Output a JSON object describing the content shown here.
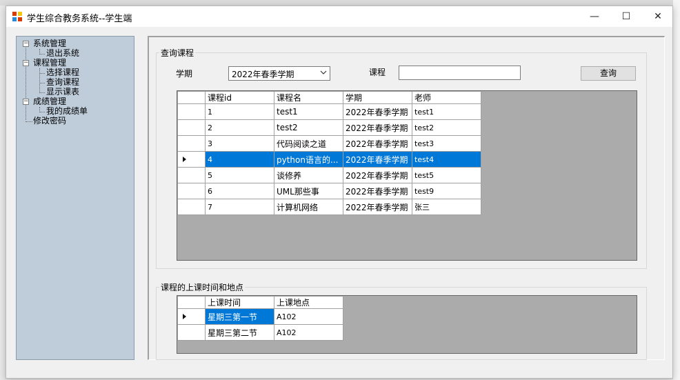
{
  "window": {
    "title": "学生综合教务系统--学生端"
  },
  "title_controls": {
    "minimize": "—",
    "maximize": "☐",
    "close": "✕"
  },
  "tree": {
    "nodes": [
      {
        "label": "系统管理",
        "children": [
          {
            "label": "退出系统"
          }
        ]
      },
      {
        "label": "课程管理",
        "children": [
          {
            "label": "选择课程"
          },
          {
            "label": "查询课程"
          },
          {
            "label": "显示课表"
          }
        ]
      },
      {
        "label": "成绩管理",
        "children": [
          {
            "label": "我的成绩单"
          }
        ]
      },
      {
        "label": "修改密码"
      }
    ],
    "expander": "−"
  },
  "query_group": {
    "title": "查询课程",
    "term_label": "学期",
    "term_value": "2022年春季学期",
    "course_label": "课程",
    "course_value": "",
    "search_button": "查询"
  },
  "course_table": {
    "columns": [
      "课程id",
      "课程名",
      "学期",
      "老师"
    ],
    "selected_row": 3,
    "rows": [
      [
        "1",
        "test1",
        "2022年春季学期",
        "test1"
      ],
      [
        "2",
        "test2",
        "2022年春季学期",
        "test2"
      ],
      [
        "3",
        "代码阅读之道",
        "2022年春季学期",
        "test3"
      ],
      [
        "4",
        "python语言的...",
        "2022年春季学期",
        "test4"
      ],
      [
        "5",
        "谈修养",
        "2022年春季学期",
        "test5"
      ],
      [
        "6",
        "UML那些事",
        "2022年春季学期",
        "test9"
      ],
      [
        "7",
        "计算机网络",
        "2022年春季学期",
        "张三"
      ]
    ]
  },
  "schedule_group": {
    "title": "课程的上课时间和地点",
    "columns": [
      "上课时间",
      "上课地点"
    ],
    "rows": [
      [
        "星期三第一节",
        "A102"
      ],
      [
        "星期三第二节",
        "A102"
      ]
    ]
  },
  "colors": {
    "selection": "#0078d7",
    "tree_bg": "#bfcddb",
    "grid_bg": "#ababab"
  }
}
